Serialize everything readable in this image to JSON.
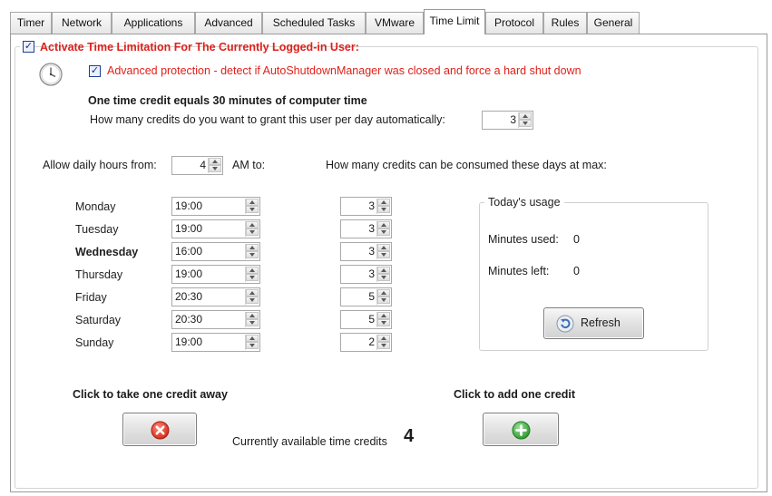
{
  "tabs": [
    {
      "label": "Timer",
      "active": false
    },
    {
      "label": "Network",
      "active": false
    },
    {
      "label": "Applications",
      "active": false
    },
    {
      "label": "Advanced",
      "active": false
    },
    {
      "label": "Scheduled Tasks",
      "active": false
    },
    {
      "label": "VMware",
      "active": false
    },
    {
      "label": "Time Limit",
      "active": true
    },
    {
      "label": "Protocol",
      "active": false
    },
    {
      "label": "Rules",
      "active": false
    },
    {
      "label": "General",
      "active": false
    }
  ],
  "activate": {
    "label": "Activate Time Limitation For The Currently Logged-in User:",
    "checked": true
  },
  "advanced_protection": {
    "label": "Advanced protection - detect if AutoShutdownManager was closed and force a hard shut down",
    "checked": true
  },
  "credit_info": "One time credit  equals 30 minutes of computer time",
  "credits_per_day": {
    "label": "How many credits do you want to grant this user per day automatically:",
    "value": "3"
  },
  "daily_hours": {
    "label": "Allow daily hours from:",
    "value": "4",
    "suffix": "AM to:"
  },
  "max_credits_label": "How many credits can be consumed these days at max:",
  "days": [
    {
      "name": "Monday",
      "until": "19:00",
      "max": "3",
      "bold": false
    },
    {
      "name": "Tuesday",
      "until": "19:00",
      "max": "3",
      "bold": false
    },
    {
      "name": "Wednesday",
      "until": "16:00",
      "max": "3",
      "bold": true
    },
    {
      "name": "Thursday",
      "until": "19:00",
      "max": "3",
      "bold": false
    },
    {
      "name": "Friday",
      "until": "20:30",
      "max": "5",
      "bold": false
    },
    {
      "name": "Saturday",
      "until": "20:30",
      "max": "5",
      "bold": false
    },
    {
      "name": "Sunday",
      "until": "19:00",
      "max": "2",
      "bold": false
    }
  ],
  "usage": {
    "title": "Today's usage",
    "minutes_used_label": "Minutes used:",
    "minutes_used": "0",
    "minutes_left_label": "Minutes left:",
    "minutes_left": "0",
    "refresh_label": "Refresh"
  },
  "take_away_label": "Click to take one credit away",
  "add_label": "Click to add one credit",
  "available": {
    "label": "Currently available time credits",
    "value": "4"
  },
  "colors": {
    "accent_red": "#e0201a",
    "remove_red": "#e23a2a",
    "add_green": "#3cae3c",
    "refresh_blue": "#3d6fb0"
  },
  "icons": {
    "clock": "clock-icon",
    "remove": "remove-x-icon",
    "add": "add-plus-icon",
    "refresh": "refresh-icon"
  }
}
